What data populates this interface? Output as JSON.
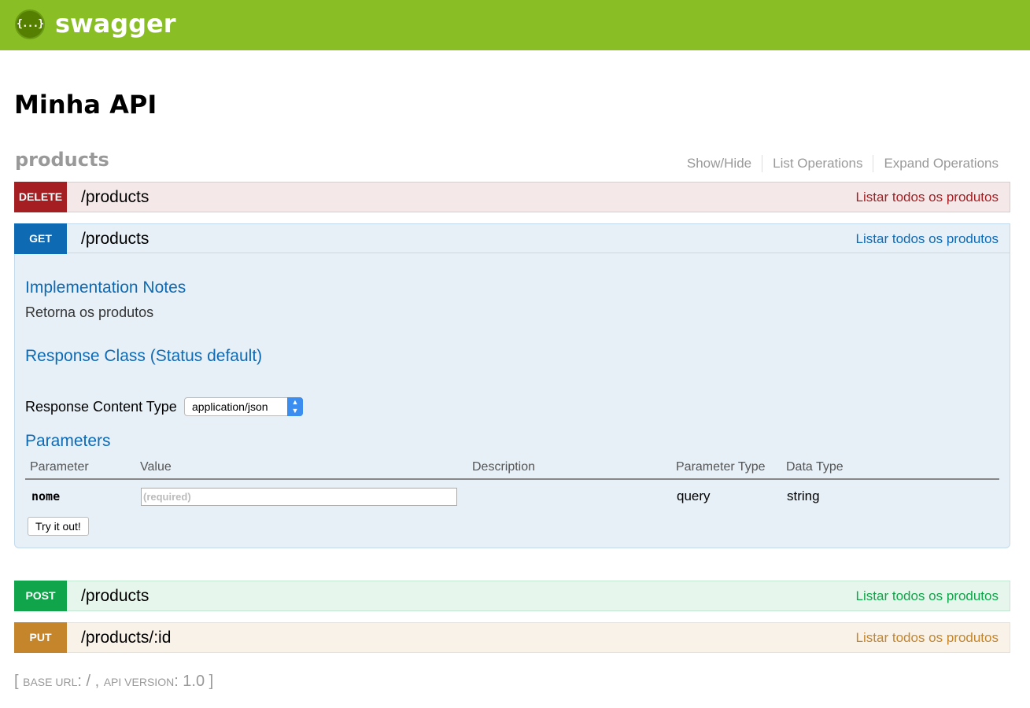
{
  "header": {
    "logo_glyph": "{...}",
    "brand": "swagger",
    "color": "#89bf24"
  },
  "api": {
    "title": "Minha API"
  },
  "resource": {
    "name": "products",
    "links": [
      "Show/Hide",
      "List Operations",
      "Expand Operations"
    ]
  },
  "operations": [
    {
      "method": "DELETE",
      "path": "/products",
      "summary": "Listar todos os produtos",
      "color": "#a41e22"
    },
    {
      "method": "GET",
      "path": "/products",
      "summary": "Listar todos os produtos",
      "color": "#0f6ab4",
      "expanded": true
    },
    {
      "method": "POST",
      "path": "/products",
      "summary": "Listar todos os produtos",
      "color": "#10a54a"
    },
    {
      "method": "PUT",
      "path": "/products/:id",
      "summary": "Listar todos os produtos",
      "color": "#c5862b"
    }
  ],
  "get_details": {
    "impl_notes_title": "Implementation Notes",
    "impl_notes_text": "Retorna os produtos",
    "response_class_title": "Response Class (Status default)",
    "response_content_type_label": "Response Content Type",
    "response_content_type_value": "application/json",
    "parameters_title": "Parameters",
    "param_headers": [
      "Parameter",
      "Value",
      "Description",
      "Parameter Type",
      "Data Type"
    ],
    "params": [
      {
        "name": "nome",
        "placeholder": "(required)",
        "description": "",
        "param_type": "query",
        "data_type": "string"
      }
    ],
    "try_button": "Try it out!"
  },
  "footer": {
    "open": "[ ",
    "base_url_label": "base url",
    "base_url_value": ": / , ",
    "api_version_label": "api version",
    "api_version_value": ": 1.0 ]"
  }
}
